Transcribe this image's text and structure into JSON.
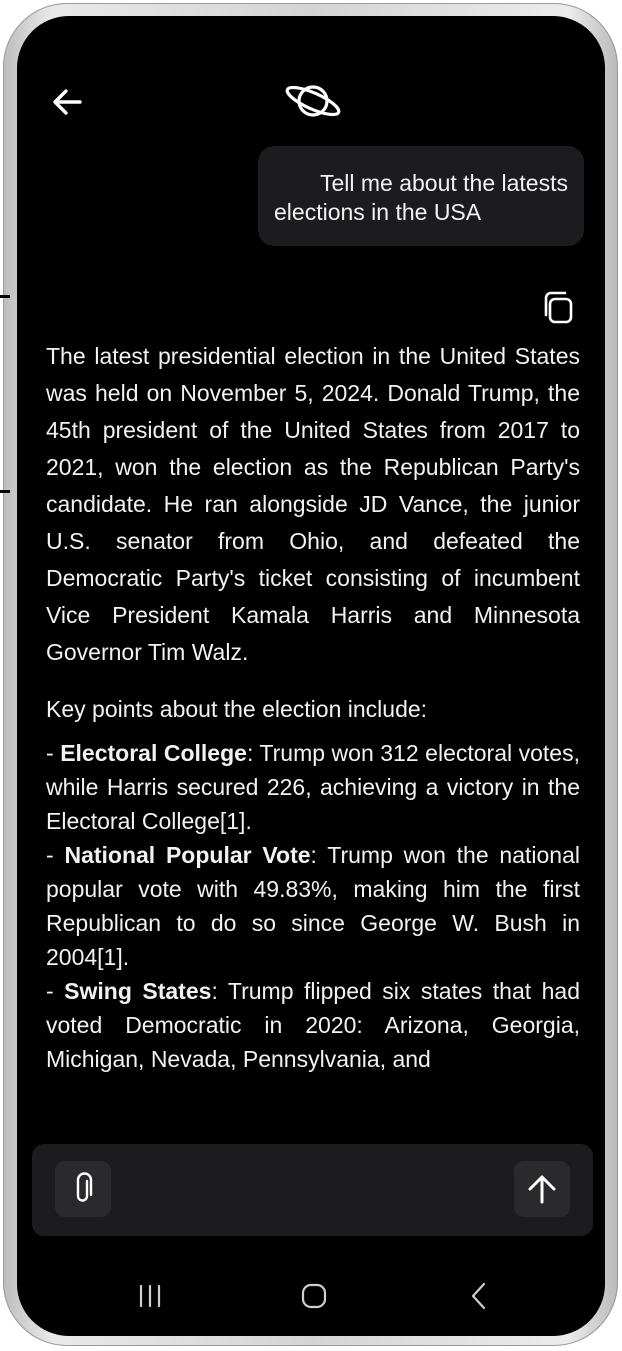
{
  "header": {
    "back_icon": "arrow-left-icon",
    "logo_icon": "planet-icon"
  },
  "user_message": {
    "line1": "Tell me about the latests",
    "line2": "elections in the USA"
  },
  "copy_icon": "copy-icon",
  "response": {
    "paragraph1": "The latest presidential election in the United States was held on November 5, 2024. Donald Trump, the 45th president of the United States from 2017 to 2021, won the election as the Republican Party's candidate. He ran alongside JD Vance, the junior U.S. senator from Ohio, and defeated the Democratic Party's ticket consisting of incumbent Vice President Kamala Harris and Minnesota Governor Tim Walz.",
    "paragraph2": "Key points about the election include:",
    "bullets": [
      {
        "prefix": "- ",
        "term": "Electoral College",
        "text": ": Trump won 312 electoral votes, while Harris secured 226, achieving a victory in the Electoral College[1]."
      },
      {
        "prefix": "- ",
        "term": "National Popular Vote",
        "text": ": Trump won the national popular vote with 49.83%, making him the first Republican to do so since George W. Bush in 2004[1]."
      },
      {
        "prefix": "- ",
        "term": "Swing States",
        "text": ": Trump flipped six states that had voted Democratic in 2020: Arizona, Georgia, Michigan, Nevada, Pennsylvania, and"
      }
    ]
  },
  "input_bar": {
    "attach_icon": "paperclip-icon",
    "send_icon": "arrow-up-icon"
  },
  "nav": {
    "recent_icon": "recent-apps-icon",
    "home_icon": "home-icon",
    "back_icon": "chevron-left-icon"
  },
  "colors": {
    "screen_bg": "#000000",
    "bubble_bg": "#1c1c1e",
    "text": "#f2f2f2"
  }
}
